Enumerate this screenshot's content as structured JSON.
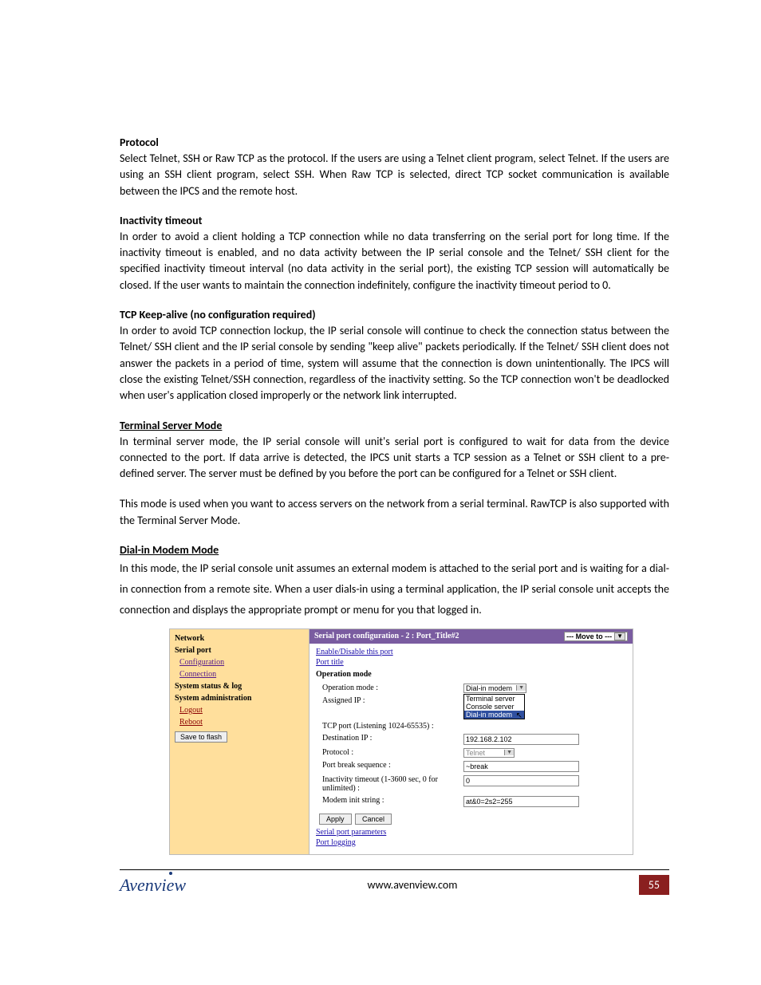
{
  "sections": {
    "protocol": {
      "heading": "Protocol",
      "body": "Select Telnet, SSH or Raw TCP as the protocol. If the users are using a Telnet client program, select Telnet. If the users are using an SSH client program, select SSH. When Raw TCP is selected, direct TCP socket communication is available between the IPCS and the remote host."
    },
    "inactivity": {
      "heading": "Inactivity timeout",
      "body": "In order to avoid a client holding a TCP connection while no data transferring on the serial port for long time. If the inactivity timeout is enabled, and no data activity between the IP serial console and the Telnet/ SSH client for the specified inactivity timeout interval (no data activity in the serial port), the existing TCP session will automatically be closed. If the user wants to maintain the connection indefinitely, configure the inactivity timeout period to 0."
    },
    "keepalive": {
      "heading": "TCP Keep-alive (no configuration required)",
      "body": "In order to avoid TCP connection lockup, the IP serial console will continue to check the connection status between the Telnet/ SSH client and the IP serial console by sending \"keep alive\" packets periodically. If the Telnet/ SSH client does not answer the packets in a period of time, system will assume that the connection is down unintentionally. The IPCS will close the existing Telnet/SSH connection, regardless of the inactivity setting. So the TCP connection won't be deadlocked when user's application closed improperly or the network link interrupted."
    },
    "terminal": {
      "heading": "Terminal Server Mode",
      "body1": "In terminal server mode, the IP serial console will unit's serial port is configured to wait for data from the device connected to the port. If data arrive is detected, the IPCS unit starts a TCP session as a Telnet or SSH client to a pre-defined server. The server must be defined by you before the port can be configured for a Telnet or SSH client.",
      "body2": "This mode is used when you want to access servers on the network from a serial terminal. RawTCP is also supported with the Terminal Server Mode."
    },
    "dialin": {
      "heading": "Dial-in Modem Mode",
      "body": "In this mode, the IP serial console unit assumes an external modem is attached to the serial port and is waiting for a dial-in connection from a remote site. When a user dials-in using a terminal application, the IP serial console unit accepts the connection and displays the appropriate prompt or menu for you that logged in."
    }
  },
  "screenshot": {
    "sidebar": {
      "network": "Network",
      "serialport": "Serial port",
      "configuration": "Configuration",
      "connection": "Connection",
      "status": "System status & log",
      "admin": "System administration",
      "logout": "Logout",
      "reboot": "Reboot",
      "savebtn": "Save to flash"
    },
    "panel": {
      "title": "Serial port configuration - 2 : Port_Title#2",
      "moveto": "--- Move to ---",
      "links": {
        "enable": "Enable/Disable this port",
        "porttitle": "Port title",
        "params": "Serial port parameters",
        "logging": "Port logging"
      },
      "opmode_heading": "Operation mode",
      "labels": {
        "opmode": "Operation mode :",
        "assigned": "Assigned IP :",
        "tcpport": "TCP port (Listening 1024-65535) :",
        "dest": "Destination IP :",
        "protocol": "Protocol :",
        "break": "Port break sequence :",
        "inactivity": "Inactivity timeout (1-3600 sec, 0 for unlimited) :",
        "modem": "Modem init string :"
      },
      "values": {
        "opmode_selected": "Dial-in modem",
        "dropdown": [
          "Terminal server",
          "Console server",
          "Dial-in modem"
        ],
        "assigned_ip": "",
        "tcpport": "",
        "dest": "192.168.2.102",
        "protocol": "Telnet",
        "break": "~break",
        "inactivity": "0",
        "modem": "at&0=2s2=255"
      },
      "buttons": {
        "apply": "Apply",
        "cancel": "Cancel"
      }
    }
  },
  "footer": {
    "logo": "Avenview",
    "url": "www.avenview.com",
    "page": "55"
  }
}
